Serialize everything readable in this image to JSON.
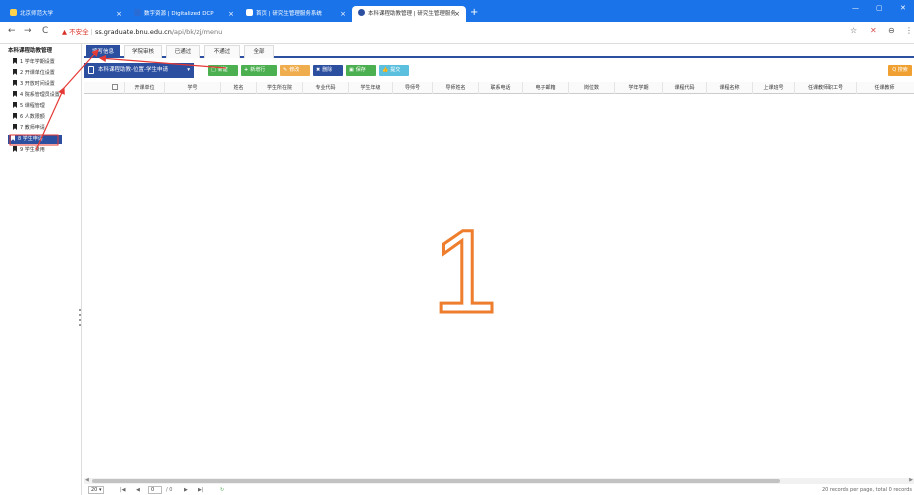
{
  "browser": {
    "tabs": [
      {
        "title": "北京师范大学",
        "active": false
      },
      {
        "title": "数字资源 | Digitalized DCP",
        "active": false
      },
      {
        "title": "首页 | 研究生管理服务系统",
        "active": false
      },
      {
        "title": "本科课程助教管理 | 研究生管理服务",
        "active": true
      }
    ],
    "new_tab": "+",
    "window_controls": {
      "minimize": "—",
      "maximize": "▢",
      "close": "✕"
    },
    "address": {
      "warning": "不安全",
      "host": "ss.graduate.bnu.edu.cn",
      "path": "/api/bk/zj/menu"
    },
    "icons": {
      "back": "←",
      "forward": "→",
      "reload": "C",
      "star": "☆",
      "ext": "✕",
      "profile": "⊖",
      "menu": "⋮"
    }
  },
  "sidebar": {
    "title": "本科课程助教管理",
    "items": [
      {
        "label": "1 学年学期设置",
        "selected": false
      },
      {
        "label": "2 开课单位设置",
        "selected": false
      },
      {
        "label": "3 开放时间设置",
        "selected": false
      },
      {
        "label": "4 院系管理员设置",
        "selected": false
      },
      {
        "label": "5 课程管理",
        "selected": false
      },
      {
        "label": "6 人数限额",
        "selected": false
      },
      {
        "label": "7 教师申请",
        "selected": false
      },
      {
        "label": "8 学生申请",
        "selected": true
      },
      {
        "label": "9 学生录用",
        "selected": false
      }
    ]
  },
  "subtabs": [
    {
      "label": "填写信息",
      "active": true
    },
    {
      "label": "学院审核",
      "active": false
    },
    {
      "label": "已通过",
      "active": false
    },
    {
      "label": "不通过",
      "active": false
    },
    {
      "label": "全部",
      "active": false
    }
  ],
  "panel": {
    "title": "本科课程助教-位置-学生申请",
    "caret": "▾"
  },
  "toolbar": {
    "buttons": [
      {
        "label": "新建",
        "icon": "□",
        "color": "#4caf50"
      },
      {
        "label": "新增行",
        "icon": "+",
        "color": "#4caf50"
      },
      {
        "label": "修改",
        "icon": "✎",
        "color": "#f0ad4e"
      },
      {
        "label": "删除",
        "icon": "✖",
        "color": "#2c4fa0"
      },
      {
        "label": "保存",
        "icon": "▣",
        "color": "#4caf50"
      },
      {
        "label": "提交",
        "icon": "👍",
        "color": "#5bc0de"
      }
    ],
    "search": "Q 搜索"
  },
  "table": {
    "columns": [
      "",
      "开课单位",
      "学号",
      "姓名",
      "学生所在院",
      "专业代码",
      "学生年级",
      "导师号",
      "导师姓名",
      "联系电话",
      "电子邮箱",
      "岗位数",
      "学年学期",
      "课程代码",
      "课程名称",
      "上课班号",
      "任课教师职工号",
      "任课教师"
    ]
  },
  "annotation": {
    "number": "1",
    "color": "#ee7d2d",
    "arrow_color": "#e53935"
  },
  "pager": {
    "page_size": "20",
    "page_input": "0",
    "total_pages": "/ 0",
    "first": "|◀",
    "prev": "◀",
    "next": "▶",
    "last": "▶|",
    "refresh": "↻",
    "summary": "20 records per page, total 0 records"
  }
}
